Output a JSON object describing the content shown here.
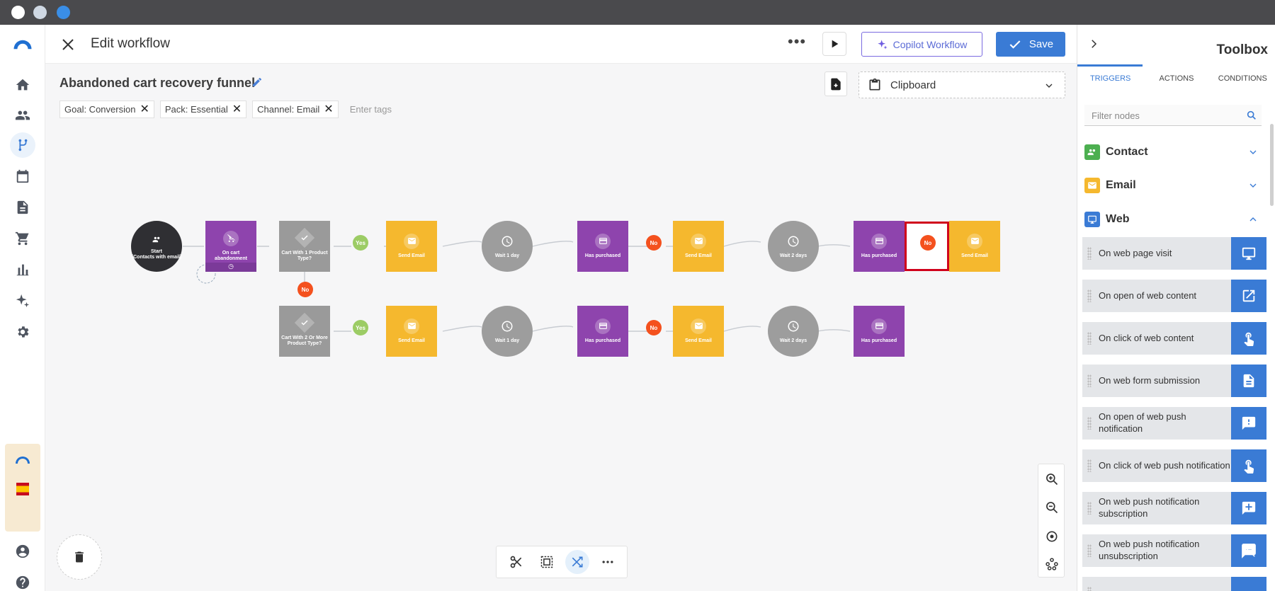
{
  "window": {
    "dots": [
      "#ffffff",
      "#cfd8e3",
      "#3a8ee6"
    ]
  },
  "topbar": {
    "title": "Edit workflow",
    "more_label": "•••",
    "copilot_label": "Copilot Workflow",
    "save_label": "Save"
  },
  "workflow": {
    "name": "Abandoned cart recovery funnel",
    "tags": [
      "Goal: Conversion",
      "Pack: Essential",
      "Channel: Email"
    ],
    "tag_placeholder": "Enter tags"
  },
  "clipboard": {
    "label": "Clipboard"
  },
  "nodes": {
    "start": "Start\n(Contacts with email)",
    "cart_abandonment": "On cart abandonment",
    "cart_1": "Cart With 1 Product Type?",
    "cart_2": "Cart With 2 Or More Product Type?",
    "send_email": "Send Email",
    "wait_1": "Wait 1 day",
    "wait_2": "Wait 2 days",
    "has_purchased": "Has purchased",
    "yes": "Yes",
    "no": "No"
  },
  "toolbox": {
    "title": "Toolbox",
    "tabs": [
      "TRIGGERS",
      "ACTIONS",
      "CONDITIONS"
    ],
    "active_tab": "TRIGGERS",
    "filter_placeholder": "Filter nodes",
    "categories": [
      {
        "label": "Contact",
        "color": "#4caf50",
        "icon": "contact-icon",
        "expanded": false
      },
      {
        "label": "Email",
        "color": "#f5b82e",
        "icon": "email-icon",
        "expanded": false
      },
      {
        "label": "Web",
        "color": "#3a7bd5",
        "icon": "web-icon",
        "expanded": true
      }
    ],
    "web_triggers": [
      {
        "label": "On web page visit",
        "icon": "monitor-icon"
      },
      {
        "label": "On open of web content",
        "icon": "open-external-icon"
      },
      {
        "label": "On click of web content",
        "icon": "click-icon"
      },
      {
        "label": "On web form submission",
        "icon": "document-icon"
      },
      {
        "label": "On open of web push notification",
        "icon": "notification-icon"
      },
      {
        "label": "On click of web push notification",
        "icon": "click-icon"
      },
      {
        "label": "On web push notification subscription",
        "icon": "subscribe-icon"
      },
      {
        "label": "On web push notification unsubscription",
        "icon": "unsubscribe-icon"
      }
    ]
  }
}
